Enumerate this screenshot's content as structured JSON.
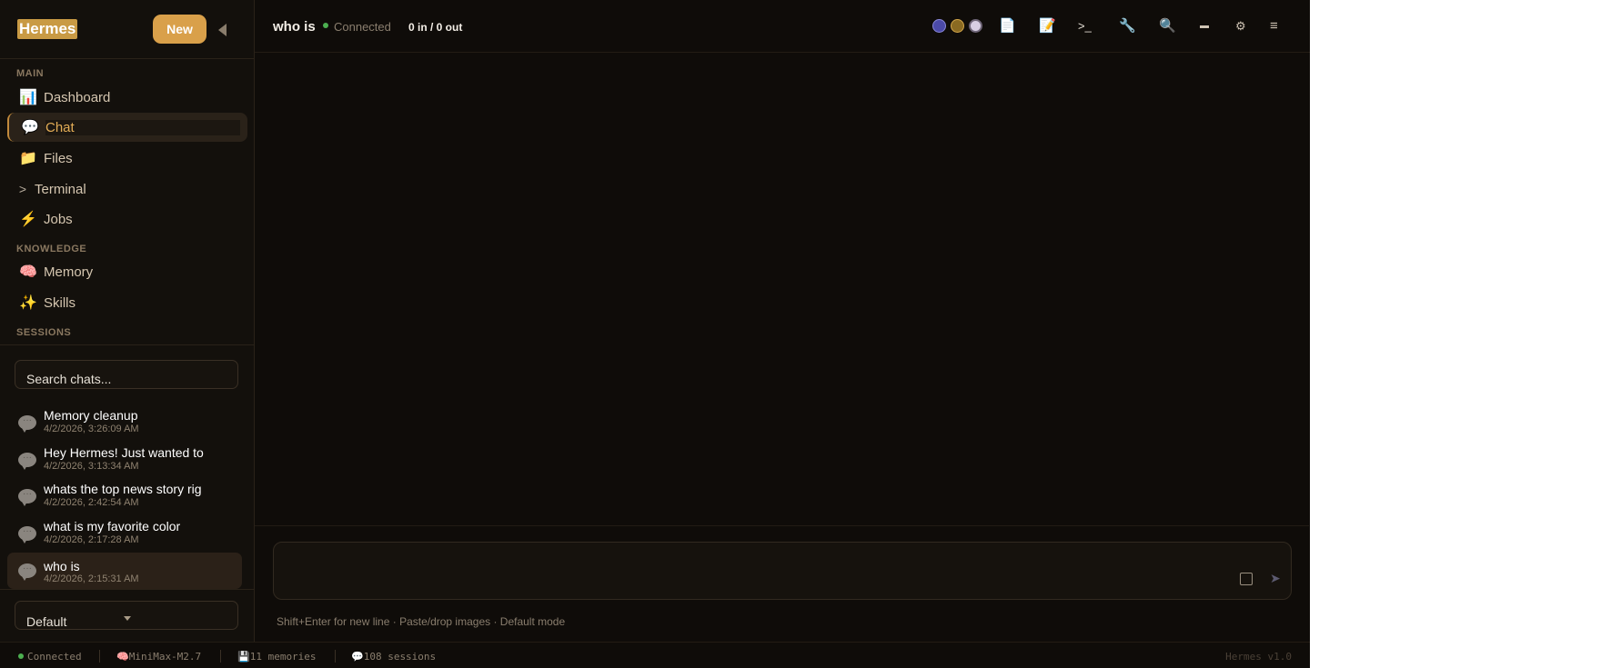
{
  "sidebar": {
    "logo": "Hermes",
    "new_button": "New",
    "sections": {
      "main": "MAIN",
      "knowledge": "KNOWLEDGE",
      "sessions": "SESSIONS"
    },
    "nav": [
      {
        "icon": "📊",
        "label": "Dashboard"
      },
      {
        "icon": "💬",
        "label": "Chat"
      },
      {
        "icon": "📁",
        "label": "Files"
      },
      {
        "icon": ">",
        "label": "Terminal"
      },
      {
        "icon": "⚡",
        "label": "Jobs"
      },
      {
        "icon": "🧠",
        "label": "Memory"
      },
      {
        "icon": "✨",
        "label": "Skills"
      }
    ],
    "search_text": "Search chats...",
    "sessions": [
      {
        "title": "Memory cleanup",
        "time": "4/2/2026, 3:26:09 AM"
      },
      {
        "title": "Hey Hermes! Just wanted to",
        "time": "4/2/2026, 3:13:34 AM"
      },
      {
        "title": "whats the top news story rig",
        "time": "4/2/2026, 2:42:54 AM"
      },
      {
        "title": "what is my favorite color",
        "time": "4/2/2026, 2:17:28 AM"
      },
      {
        "title": "who is",
        "time": "4/2/2026, 2:15:31 AM"
      }
    ],
    "profile": "Default"
  },
  "topbar": {
    "title": "who is",
    "status": "Connected",
    "io": "0 in / 0 out",
    "icons": [
      "file-icon",
      "memo-icon",
      "terminal-icon",
      "wrench-icon",
      "search-icon",
      "keyboard-icon",
      "gear-icon",
      "menu-icon"
    ],
    "terminal_glyph": ">_"
  },
  "composer": {
    "hint": "Shift+Enter for new line · Paste/drop images · Default mode"
  },
  "statusbar": {
    "connected": "Connected",
    "model": "MiniMax-M2.7",
    "memories": "11 memories",
    "sessions": "108 sessions",
    "version": "Hermes v1.0"
  },
  "colors": {
    "accent": "#d9a04a",
    "background": "#0f0c09",
    "connected": "#4caf50"
  }
}
